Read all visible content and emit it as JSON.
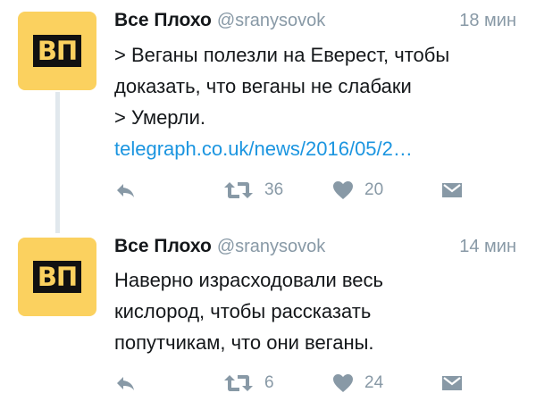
{
  "tweets": [
    {
      "author_name": "Все Плохо",
      "author_handle": "@sranysovok",
      "time": "18 мин",
      "avatar_text": "ВП",
      "text_lines": [
        "> Веганы полезли на Еверест, чтобы",
        "доказать, что веганы не слабаки",
        "> Умерли."
      ],
      "link_text": "telegraph.co.uk/news/2016/05/2…",
      "retweets": "36",
      "likes": "20"
    },
    {
      "author_name": "Все Плохо",
      "author_handle": "@sranysovok",
      "time": "14 мин",
      "avatar_text": "ВП",
      "text_lines": [
        "Наверно израсходовали весь",
        "кислород, чтобы рассказать",
        "попутчикам, что они веганы."
      ],
      "retweets": "6",
      "likes": "24"
    }
  ],
  "colors": {
    "avatar_bg": "#fbd15f",
    "link": "#1b95e0",
    "secondary_text": "#8899a6",
    "thread_line": "#e1e8ed"
  },
  "icons": [
    "reply-icon",
    "retweet-icon",
    "heart-icon",
    "direct-message-icon"
  ]
}
